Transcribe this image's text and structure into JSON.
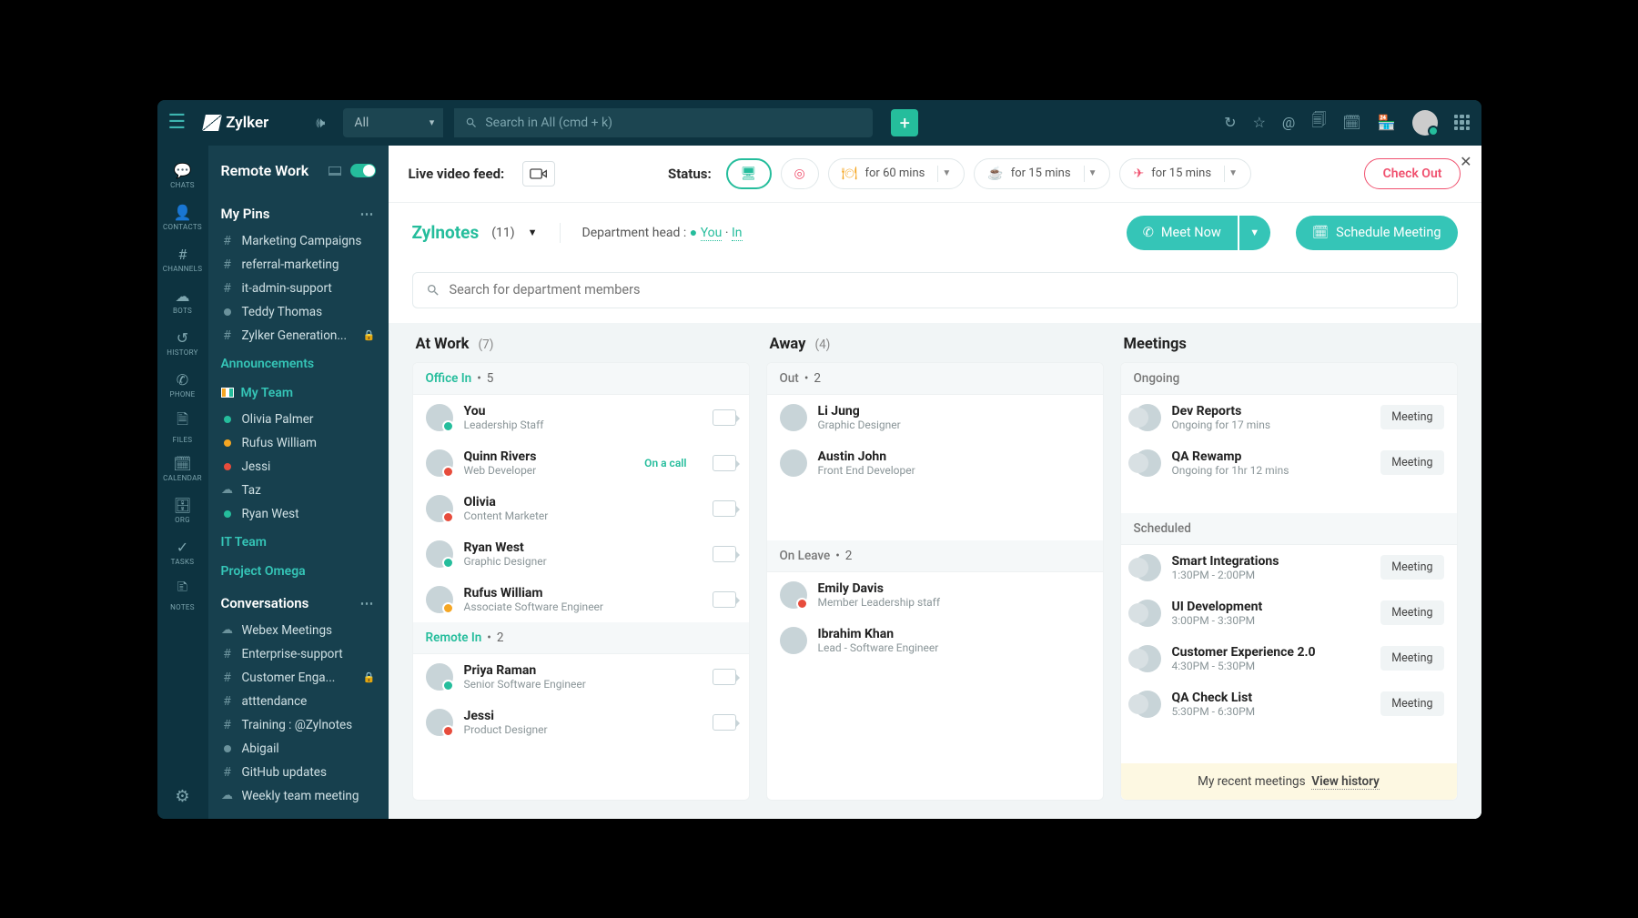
{
  "brand": "Zylker",
  "search_filter": "All",
  "search_placeholder": "Search in All (cmd + k)",
  "rail": [
    {
      "icon": "💬",
      "label": "CHATS"
    },
    {
      "icon": "👤",
      "label": "CONTACTS"
    },
    {
      "icon": "#",
      "label": "CHANNELS"
    },
    {
      "icon": "☁",
      "label": "BOTS"
    },
    {
      "icon": "↺",
      "label": "HISTORY"
    },
    {
      "icon": "✆",
      "label": "PHONE"
    },
    {
      "icon": "🗎",
      "label": "FILES"
    },
    {
      "icon": "🗓",
      "label": "CALENDAR"
    },
    {
      "icon": "🗄",
      "label": "ORG"
    },
    {
      "icon": "✓",
      "label": "TASKS"
    },
    {
      "icon": "🗈",
      "label": "NOTES"
    }
  ],
  "sidepanel": {
    "title": "Remote Work",
    "pins_header": "My Pins",
    "pins": [
      {
        "t": "hash",
        "label": "Marketing Campaigns"
      },
      {
        "t": "hash",
        "label": "referral-marketing"
      },
      {
        "t": "hash",
        "label": "it-admin-support"
      },
      {
        "t": "bullet",
        "label": "Teddy Thomas"
      },
      {
        "t": "hash",
        "label": "Zylker Generation...",
        "locked": true
      }
    ],
    "announcements": "Announcements",
    "my_team": "My Team",
    "people": [
      {
        "status": "green",
        "label": "Olivia Palmer"
      },
      {
        "status": "orange",
        "label": "Rufus William"
      },
      {
        "status": "red",
        "label": "Jessi"
      },
      {
        "t": "cloud",
        "label": "Taz"
      },
      {
        "status": "green",
        "label": "Ryan West"
      }
    ],
    "it_team": "IT Team",
    "project_omega": "Project Omega",
    "conversations_header": "Conversations",
    "conversations": [
      {
        "t": "cloud",
        "label": "Webex Meetings"
      },
      {
        "t": "hash",
        "label": "Enterprise-support"
      },
      {
        "t": "hash",
        "label": "Customer Enga...",
        "locked": true
      },
      {
        "t": "hash",
        "label": "atttendance"
      },
      {
        "t": "hash",
        "label": "Training : @Zylnotes"
      },
      {
        "t": "bullet",
        "label": "Abigail"
      },
      {
        "t": "hash",
        "label": "GitHub updates"
      },
      {
        "t": "cloud",
        "label": "Weekly team meeting"
      }
    ]
  },
  "status": {
    "live_feed": "Live video feed:",
    "status_label": "Status:",
    "opts": [
      {
        "icon": "🖥",
        "text": "",
        "cls": "active green-ic"
      },
      {
        "icon": "◎",
        "text": "",
        "cls": "red-ic"
      },
      {
        "icon": "🍽",
        "text": "for 60 mins",
        "cls": "orange-ic split"
      },
      {
        "icon": "☕",
        "text": "for 15 mins",
        "cls": "orange-ic split"
      },
      {
        "icon": "✈",
        "text": "for 15 mins",
        "cls": "red-ic split"
      }
    ],
    "checkout": "Check Out"
  },
  "dept": {
    "name": "Zylnotes",
    "count": "(11)",
    "head_label": "Department head :",
    "you": "You",
    "in": "In",
    "meet_now": "Meet Now",
    "schedule": "Schedule Meeting",
    "search_placeholder": "Search for department members"
  },
  "atwork": {
    "title": "At Work",
    "count": "(7)",
    "office_in": {
      "label": "Office In",
      "count": "5"
    },
    "office_people": [
      {
        "name": "You",
        "role": "Leadership Staff",
        "st": "green",
        "cam": true
      },
      {
        "name": "Quinn Rivers",
        "role": "Web Developer",
        "st": "red",
        "status": "On a call",
        "cam": true
      },
      {
        "name": "Olivia",
        "role": "Content Marketer",
        "st": "red",
        "cam": true
      },
      {
        "name": "Ryan West",
        "role": "Graphic Designer",
        "st": "green",
        "cam": true
      },
      {
        "name": "Rufus William",
        "role": "Associate Software Engineer",
        "st": "orange",
        "cam": true
      }
    ],
    "remote_in": {
      "label": "Remote In",
      "count": "2"
    },
    "remote_people": [
      {
        "name": "Priya Raman",
        "role": "Senior Software Engineer",
        "st": "green",
        "cam": true
      },
      {
        "name": "Jessi",
        "role": "Product Designer",
        "st": "red",
        "cam": true
      }
    ]
  },
  "away": {
    "title": "Away",
    "count": "(4)",
    "out": {
      "label": "Out",
      "count": "2"
    },
    "out_people": [
      {
        "name": "Li Jung",
        "role": "Graphic Designer",
        "st": "none"
      },
      {
        "name": "Austin John",
        "role": "Front End Developer",
        "st": "none"
      }
    ],
    "leave": {
      "label": "On Leave",
      "count": "2"
    },
    "leave_people": [
      {
        "name": "Emily Davis",
        "role": "Member Leadership staff",
        "st": "red"
      },
      {
        "name": "Ibrahim Khan",
        "role": "Lead - Software Engineer",
        "st": "none"
      }
    ]
  },
  "meetings": {
    "title": "Meetings",
    "ongoing_label": "Ongoing",
    "ongoing": [
      {
        "name": "Dev Reports",
        "sub": "Ongoing for 17 mins",
        "btn": "Meeting"
      },
      {
        "name": "QA Rewamp",
        "sub": "Ongoing for 1hr 12 mins",
        "btn": "Meeting"
      }
    ],
    "scheduled_label": "Scheduled",
    "scheduled": [
      {
        "name": "Smart Integrations",
        "sub": "1:30PM - 2:00PM",
        "btn": "Meeting"
      },
      {
        "name": "UI Development",
        "sub": "3:00PM - 3:30PM",
        "btn": "Meeting"
      },
      {
        "name": "Customer Experience 2.0",
        "sub": "4:30PM - 5:30PM",
        "btn": "Meeting"
      },
      {
        "name": "QA Check List",
        "sub": "5:30PM - 6:30PM",
        "btn": "Meeting"
      }
    ],
    "recent_label": "My recent meetings",
    "view_history": "View history"
  }
}
